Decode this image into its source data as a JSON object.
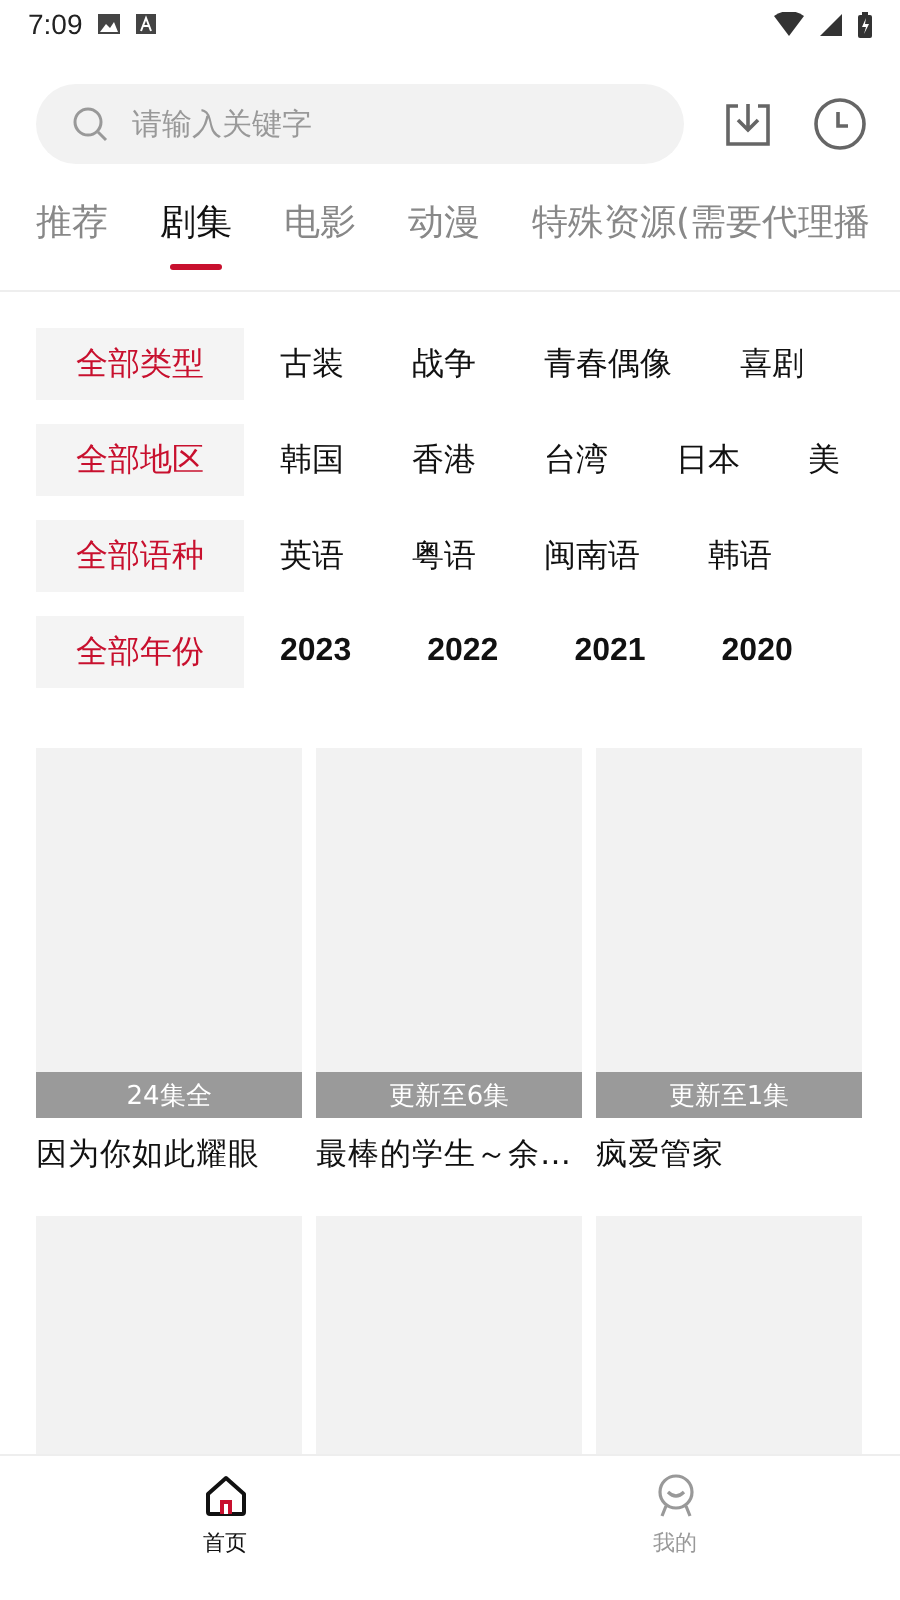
{
  "status_bar": {
    "time": "7:09"
  },
  "search": {
    "placeholder": "请输入关键字"
  },
  "tabs": [
    {
      "label": "推荐",
      "selected": false
    },
    {
      "label": "剧集",
      "selected": true
    },
    {
      "label": "电影",
      "selected": false
    },
    {
      "label": "动漫",
      "selected": false
    },
    {
      "label": "特殊资源(需要代理播",
      "selected": false
    }
  ],
  "filters": [
    {
      "all": "全部类型",
      "options": [
        "古装",
        "战争",
        "青春偶像",
        "喜剧"
      ]
    },
    {
      "all": "全部地区",
      "options": [
        "韩国",
        "香港",
        "台湾",
        "日本",
        "美"
      ]
    },
    {
      "all": "全部语种",
      "options": [
        "英语",
        "粤语",
        "闽南语",
        "韩语"
      ]
    },
    {
      "all": "全部年份",
      "options": [
        "2023",
        "2022",
        "2021",
        "2020"
      ]
    }
  ],
  "cards": [
    {
      "kind": "titled",
      "badge": "24集全",
      "title": "因为你如此耀眼"
    },
    {
      "kind": "titled",
      "badge": "更新至6集",
      "title": "最棒的学生～余…"
    },
    {
      "kind": "titled",
      "badge": "更新至1集",
      "title": "疯爱管家"
    },
    {
      "kind": "blank"
    },
    {
      "kind": "blank"
    },
    {
      "kind": "blank"
    }
  ],
  "bottom_nav": [
    {
      "kind": "home",
      "label": "首页",
      "selected": true
    },
    {
      "kind": "profile",
      "label": "我的",
      "selected": false
    }
  ]
}
